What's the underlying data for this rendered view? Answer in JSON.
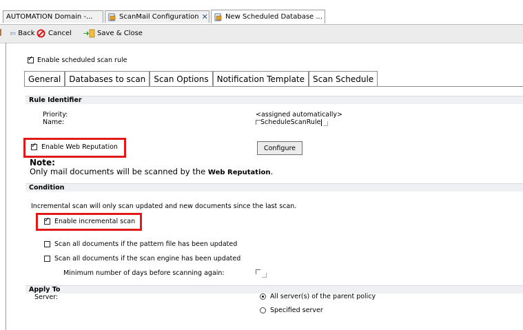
{
  "tabs_bar": {
    "tabs": [
      {
        "label": "AUTOMATION Domain -..."
      },
      {
        "label": "ScanMail Configuration"
      },
      {
        "label": "New Scheduled Database ..."
      }
    ]
  },
  "toolbar": {
    "back_label": "Back",
    "cancel_label": "Cancel",
    "save_close_label": "Save & Close"
  },
  "enable_rule": {
    "label": "Enable scheduled scan rule",
    "checked": true
  },
  "content_tabs": [
    "General",
    "Databases to scan",
    "Scan Options",
    "Notification Template",
    "Scan Schedule"
  ],
  "rule_identifier": {
    "header": "Rule Identifier",
    "priority_label": "Priority:",
    "priority_value": "<assigned automatically>",
    "name_label": "Name:",
    "name_value": "ScheduleScanRule"
  },
  "web_reputation": {
    "label": "Enable Web Reputation",
    "checked": true,
    "configure_label": "Configure",
    "note_title": "Note:",
    "note_text": "Only mail documents will be scanned by the ",
    "note_bold": "Web Reputation",
    "note_end": "."
  },
  "condition": {
    "header": "Condition",
    "description": "Incremental scan will only scan updated and new documents since the last scan.",
    "incremental_label": "Enable incremental scan",
    "incremental_checked": true,
    "pattern_label": "Scan all documents if the pattern file has been updated",
    "engine_label": "Scan all documents if the scan engine has been updated",
    "min_days_label": "Minimum number of days before scanning again:"
  },
  "apply_to": {
    "header": "Apply To",
    "server_label": "Server:",
    "option_all": "All server(s) of the parent policy",
    "option_specified": "Specified server"
  },
  "colors": {
    "highlight": "#e01818",
    "section_bg": "#eef0f4",
    "toolbar_bg": "#ececec"
  }
}
